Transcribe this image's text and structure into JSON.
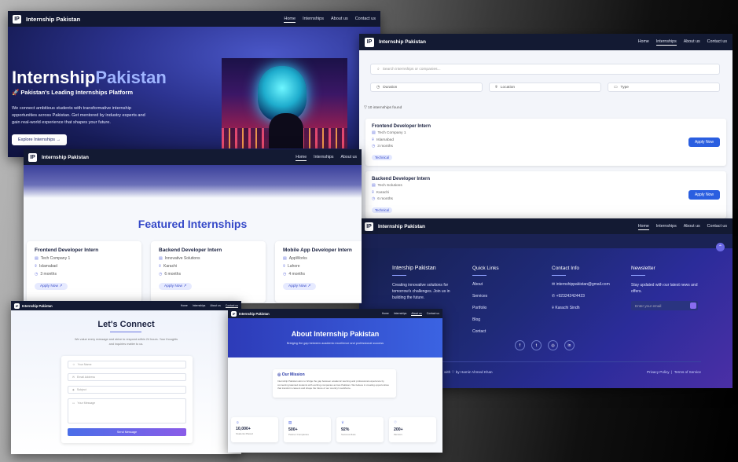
{
  "brand": "Internship Pakistan",
  "logo_mark": "IP",
  "nav": [
    "Home",
    "Internships",
    "About us",
    "Contact us"
  ],
  "hero": {
    "title_a": "Internship",
    "title_b": "Pakistan",
    "subtitle": "🚀 Pakistan's Leading Internships Platform",
    "description": "We connect ambitious students with transformative internship opportunities across Pakistan. Get mentored by industry experts and gain real-world experience that shapes your future.",
    "cta": "Explore Internships →"
  },
  "featured": {
    "title": "Featured Internships",
    "cards": [
      {
        "title": "Frontend Developer Intern",
        "company": "Tech Company 1",
        "location": "Islamabad",
        "duration": "3 months",
        "button": "Apply Now ↗"
      },
      {
        "title": "Backend Developer Intern",
        "company": "Innovative Solutions",
        "location": "Karachi",
        "duration": "6 months",
        "button": "Apply Now ↗"
      },
      {
        "title": "Mobile App Developer Intern",
        "company": "AppWorks",
        "location": "Lahore",
        "duration": "4 months",
        "button": "Apply Now ↗"
      }
    ]
  },
  "listing": {
    "search_placeholder": "Search internships or companies...",
    "filters": [
      "Duration",
      "Location",
      "Type"
    ],
    "found": "10 internships found",
    "items": [
      {
        "title": "Frontend Developer Intern",
        "company": "Tech Company 1",
        "location": "Islamabad",
        "duration": "3 months",
        "tag": "Technical",
        "button": "Apply Now"
      },
      {
        "title": "Backend Developer Intern",
        "company": "Tech Solutions",
        "location": "Karachi",
        "duration": "6 months",
        "tag": "Technical",
        "button": "Apply Now"
      }
    ]
  },
  "footer": {
    "brand": "Intership Pakistan",
    "about": "Creating innovative solutions for tomorrow's challenges. Join us in building the future.",
    "quick_title": "Quick Links",
    "quick_links": [
      "About",
      "Services",
      "Portfolio",
      "Blog",
      "Contact"
    ],
    "contact_title": "Contact Info",
    "email": "internshippakistan@gmail.com",
    "phone": "+923242424423",
    "address": "Karachi Sindh",
    "newsletter_title": "Newsletter",
    "newsletter_text": "Stay updated with our latest news and offers.",
    "newsletter_placeholder": "Enter your email",
    "socials": [
      "f",
      "t",
      "◎",
      "in"
    ],
    "credit": "with ♡ by Hamiz Ahmed Khan",
    "privacy": "Privacy Policy",
    "terms": "Terms of Service"
  },
  "contact": {
    "title": "Let's Connect",
    "description": "We value every message and strive to respond within 24 hours. Your thoughts and inquiries matter to us.",
    "name_ph": "Your Name",
    "email_ph": "Email Address",
    "subject_ph": "Subject",
    "message_ph": "Your Message",
    "send": "Send Message"
  },
  "about": {
    "title": "About Internship Pakistan",
    "subtitle": "Bridging the gap between academic excellence and professional success",
    "mission_title": "Our Mission",
    "mission_text": "Internship Pakistan aims to bridge the gap between academic learning and professional experience by connecting talented students with exciting companies across Pakistan. We believe in creating opportunities that transform careers and shape the future of our country's workforce.",
    "stats": [
      {
        "value": "10,000+",
        "label": "Students Placed"
      },
      {
        "value": "500+",
        "label": "Partner Companies"
      },
      {
        "value": "92%",
        "label": "Success Rate"
      },
      {
        "value": "200+",
        "label": "Mentors"
      }
    ]
  },
  "colors": {
    "nav": "#131a33",
    "accent": "#3549c8",
    "button": "#2a5ee0"
  }
}
